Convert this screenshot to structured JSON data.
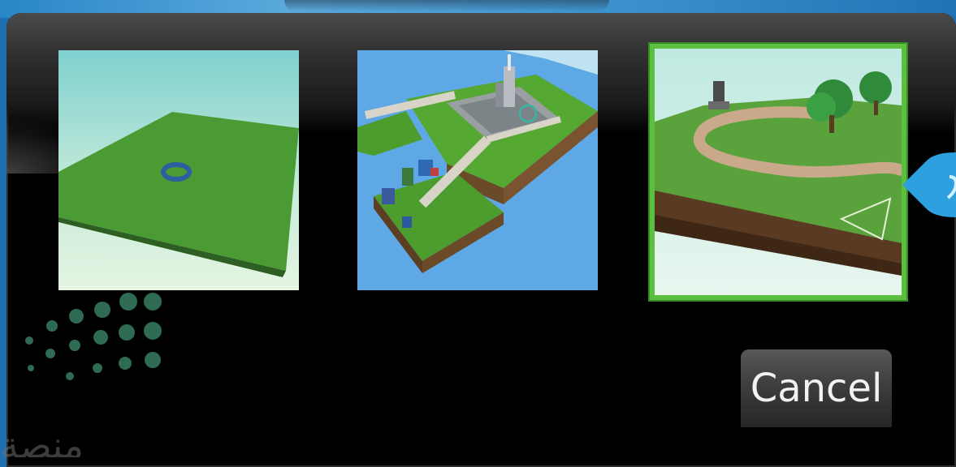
{
  "dialog": {
    "templates": [
      {
        "id": "baseplate",
        "selected": false
      },
      {
        "id": "city-island",
        "selected": false
      },
      {
        "id": "hills-path",
        "selected": true
      }
    ],
    "cancel_label": "Cancel"
  },
  "watermark": {
    "text": "منصة"
  },
  "colors": {
    "dialog_bg": "#000000",
    "selection_border": "#5bbf3f",
    "desktop_bg": "#1e6fb0",
    "accent_tab": "#2ea0e0"
  }
}
